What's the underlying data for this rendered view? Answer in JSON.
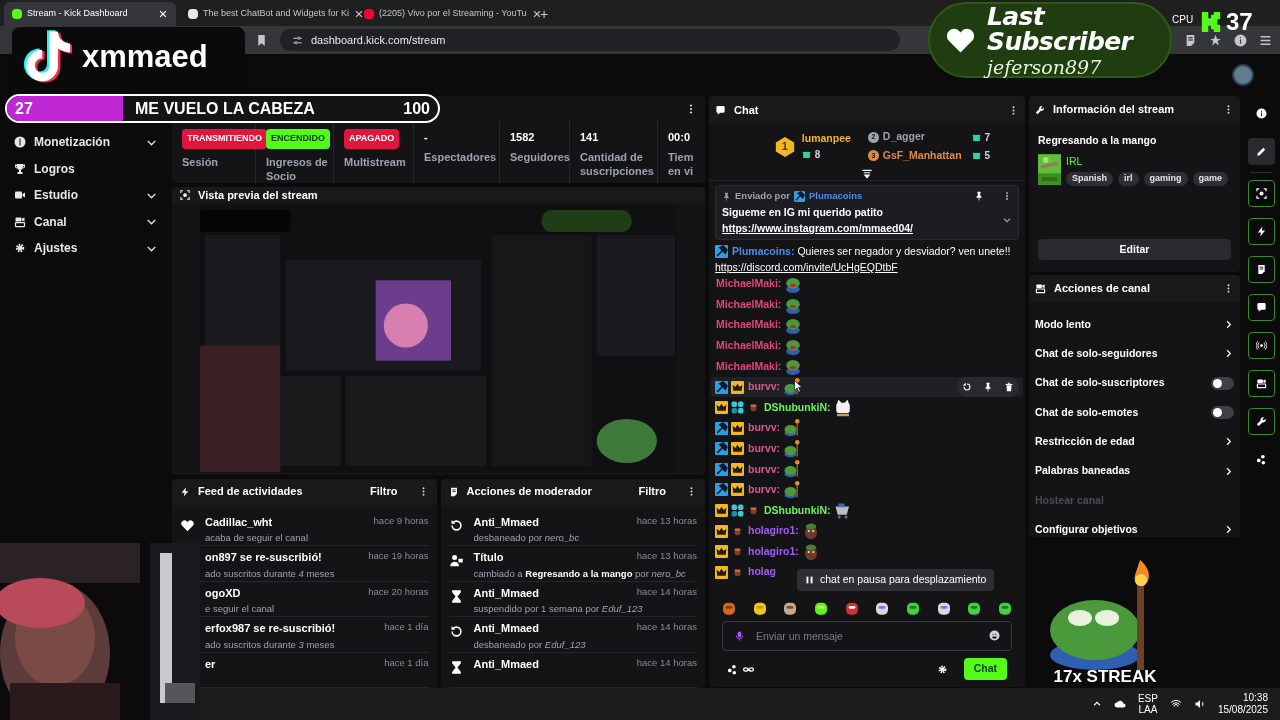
{
  "browser": {
    "tabs": [
      {
        "title": "Stream - Kick Dashboard",
        "selected": true
      },
      {
        "title": "The best ChatBot and Widgets for Ki",
        "selected": false
      },
      {
        "title": "(2205) Vivo por el Streaming - YouTu",
        "selected": false
      }
    ],
    "new_tab": "+",
    "url": "dashboard.kick.com/stream"
  },
  "overlays": {
    "tiktok_name": "xmmaed",
    "last_subscriber": {
      "title": "Last Subscriber",
      "name": "jeferson897"
    },
    "cpu": "CPU",
    "counter": "37",
    "goal": {
      "current": "27",
      "title": "ME VUELO LA CABEZA",
      "target": "100",
      "level": 0.27
    },
    "streak": "17x STREAK"
  },
  "sidebar": {
    "items": [
      {
        "label": "Monetización",
        "kind": "group"
      },
      {
        "label": "Logros",
        "kind": "link"
      },
      {
        "label": "Estudio",
        "kind": "group"
      },
      {
        "label": "Canal",
        "kind": "group"
      },
      {
        "label": "Ajustes",
        "kind": "group"
      }
    ]
  },
  "stats": [
    {
      "kind": "badge",
      "value": "TRANSMITIENDO",
      "color": "#e0163f",
      "label": "Sesión"
    },
    {
      "kind": "badge",
      "value": "ENCENDIDO",
      "color": "#53fc18",
      "label": "Ingresos de Socio"
    },
    {
      "kind": "badge",
      "value": "APAGADO",
      "color": "#e0163f",
      "label": "Multistream"
    },
    {
      "kind": "number",
      "value": "-",
      "label": "Espectadores"
    },
    {
      "kind": "number",
      "value": "1582",
      "label": "Seguidores"
    },
    {
      "kind": "number",
      "value": "141",
      "label": "Cantidad de suscripciones"
    },
    {
      "kind": "number",
      "value": "00:0",
      "label": "Tiem\nen vi"
    }
  ],
  "preview": {
    "title": "Vista previa del stream"
  },
  "feed": {
    "title": "Feed de actividades",
    "filter": "Filtro",
    "items": [
      {
        "kind": "follow",
        "title": "Cadillac_wht",
        "time": "hace 9 horas",
        "detail": "acaba de seguir el canal"
      },
      {
        "title": "on897 se re-suscribió!",
        "time": "hace 19 horas",
        "detail": "ado suscritos durante *4* meses"
      },
      {
        "title": "ogoXD",
        "time": "hace 20 horas",
        "detail": "e seguir el canal"
      },
      {
        "title": "erfox987 se re-suscribió!",
        "time": "hace 1 día",
        "detail": "ado suscritos durante *3* meses"
      },
      {
        "title": "er",
        "time": "hace 1 día"
      }
    ]
  },
  "moderation": {
    "title": "Acciones de moderador",
    "filter": "Filtro",
    "items": [
      {
        "kind": "unban",
        "title": "Anti_Mmaed",
        "time": "hace 13 horas",
        "detail": "desbaneado por *nero_bc*"
      },
      {
        "kind": "title",
        "title": "Título",
        "time": "hace 13 horas",
        "detail": "cambiado a **Regresando a la mango** por *nero_bc*"
      },
      {
        "kind": "timeout",
        "title": "Anti_Mmaed",
        "time": "hace 14 horas",
        "detail": "suspendido por 1 semana por *Eduf_123*"
      },
      {
        "kind": "unban",
        "title": "Anti_Mmaed",
        "time": "hace 14 horas",
        "detail": "desbaneado por *Eduf_123*"
      },
      {
        "kind": "timeout",
        "title": "Anti_Mmaed",
        "time": "hace 14 horas"
      }
    ]
  },
  "chat": {
    "title": "Chat",
    "leaders": [
      {
        "rank": "1",
        "name": "lumanpee",
        "count": "8",
        "color": "#f2b824"
      },
      {
        "rank": "2",
        "name": "D_agger",
        "count": "7",
        "color": "#9ca3af"
      },
      {
        "rank": "3",
        "name": "GsF_Manhattan",
        "count": "5",
        "color": "#e08a4a"
      }
    ],
    "pinned": {
      "label": "Enviado por",
      "user": "Plumacoins",
      "text": "Sigueme en IG mi querido patito",
      "link": "https://www.instagram.com/mmaed04/"
    },
    "messages": [
      {
        "user": "Plumacoins:",
        "color": "#4f8fe8",
        "moderator": true,
        "founder": false,
        "og": false,
        "subscriber": false,
        "text": "Quieres ser negador y desviador? ven unete!!",
        "link": "https://discord.com/invite/UcHgEQDtbF",
        "hovered": false
      },
      {
        "user": "MichaelMaki:",
        "color": "#e0457b",
        "moderator": false,
        "founder": false,
        "og": false,
        "subscriber": false,
        "hovered": false
      },
      {
        "user": "MichaelMaki:",
        "color": "#e0457b",
        "moderator": false,
        "founder": false,
        "og": false,
        "subscriber": false,
        "hovered": false
      },
      {
        "user": "MichaelMaki:",
        "color": "#e0457b",
        "moderator": false,
        "founder": false,
        "og": false,
        "subscriber": false,
        "hovered": false
      },
      {
        "user": "MichaelMaki:",
        "color": "#e0457b",
        "moderator": false,
        "founder": false,
        "og": false,
        "subscriber": false,
        "hovered": false
      },
      {
        "user": "MichaelMaki:",
        "color": "#e0457b",
        "moderator": false,
        "founder": false,
        "og": false,
        "subscriber": false,
        "hovered": false
      },
      {
        "user": "burvv:",
        "color": "#d9578a",
        "moderator": true,
        "founder": true,
        "og": false,
        "subscriber": false,
        "hovered": true
      },
      {
        "user": "DShubunkiN:",
        "color": "#6cf25a",
        "moderator": false,
        "founder": true,
        "og": true,
        "subscriber": true,
        "hovered": false
      },
      {
        "user": "burvv:",
        "color": "#d9578a",
        "moderator": true,
        "founder": true,
        "og": false,
        "subscriber": false,
        "hovered": false
      },
      {
        "user": "burvv:",
        "color": "#d9578a",
        "moderator": true,
        "founder": true,
        "og": false,
        "subscriber": false,
        "hovered": false
      },
      {
        "user": "burvv:",
        "color": "#d9578a",
        "moderator": true,
        "founder": true,
        "og": false,
        "subscriber": false,
        "hovered": false
      },
      {
        "user": "burvv:",
        "color": "#d9578a",
        "moderator": true,
        "founder": true,
        "og": false,
        "subscriber": false,
        "hovered": false
      },
      {
        "user": "DShubunkiN:",
        "color": "#6cf25a",
        "moderator": false,
        "founder": true,
        "og": true,
        "subscriber": true,
        "hovered": false
      },
      {
        "user": "holagiro1:",
        "color": "#a35cf5",
        "moderator": false,
        "founder": true,
        "og": false,
        "subscriber": true,
        "hovered": false
      },
      {
        "user": "holagiro1:",
        "color": "#a35cf5",
        "moderator": false,
        "founder": true,
        "og": false,
        "subscriber": true,
        "hovered": false
      },
      {
        "user": "holag",
        "color": "#a35cf5",
        "moderator": false,
        "founder": true,
        "og": false,
        "subscriber": true,
        "hovered": false
      }
    ],
    "paused": "chat en pausa para desplazamiento",
    "placeholder": "Enviar un mensaje",
    "send": "Chat"
  },
  "stream_info": {
    "title": "Información del stream",
    "stream_title": "Regresando a la mango",
    "category": "IRL",
    "tags": [
      "Spanish",
      "irl",
      "gaming",
      "game"
    ],
    "edit": "Editar"
  },
  "channel_actions": {
    "title": "Acciones de canal",
    "items": [
      {
        "label": "Modo lento",
        "kind": "link",
        "disabled": false
      },
      {
        "label": "Chat de solo-seguidores",
        "kind": "link",
        "disabled": false
      },
      {
        "label": "Chat de solo-suscriptores",
        "kind": "toggle",
        "on": false,
        "disabled": false
      },
      {
        "label": "Chat de solo-emotes",
        "kind": "toggle",
        "on": false,
        "disabled": false
      },
      {
        "label": "Restricción de edad",
        "kind": "link",
        "disabled": false
      },
      {
        "label": "Palabras baneadas",
        "kind": "link",
        "disabled": false
      },
      {
        "label": "Hostear canal",
        "disabled": true
      },
      {
        "label": "Configurar objetivos",
        "kind": "link",
        "disabled": false
      }
    ]
  },
  "rail": [
    {
      "selected": false,
      "docked": false
    },
    {
      "selected": true,
      "docked": false
    },
    {
      "selected": false,
      "docked": true
    },
    {
      "selected": false,
      "docked": true
    },
    {
      "selected": false,
      "docked": true
    },
    {
      "selected": false,
      "docked": true
    },
    {
      "selected": false,
      "docked": true
    },
    {
      "selected": false,
      "docked": true
    },
    {
      "selected": false,
      "docked": true
    },
    {
      "selected": false,
      "docked": false
    }
  ],
  "taskbar": {
    "lang": "ESP",
    "layout": "LAA",
    "time": "10:38",
    "date": "15/08/2025"
  }
}
